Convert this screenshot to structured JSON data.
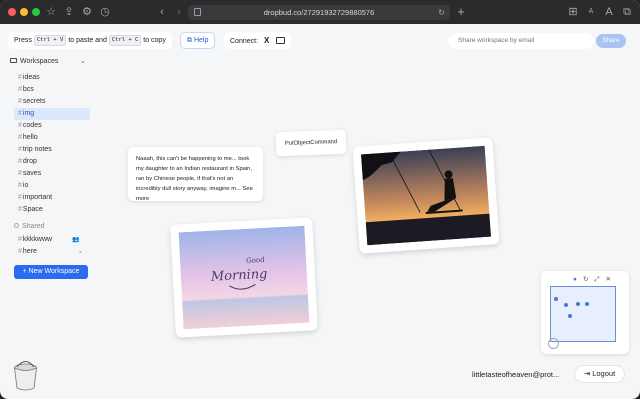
{
  "browser": {
    "url": "dropbud.co/27291932729880576",
    "controls": [
      "back",
      "forward",
      "reload",
      "new-tab"
    ]
  },
  "toolbar": {
    "paste_hint_press": "Press",
    "paste_key": "Ctrl + V",
    "paste_hint_mid": "to paste and",
    "copy_key": "Ctrl + C",
    "paste_hint_end": "to copy",
    "help_label": "Help",
    "connect_label": "Connect:",
    "connect_x": "X",
    "share_placeholder": "Share workspace by email",
    "share_button": "Share"
  },
  "sidebar": {
    "workspaces_label": "Workspaces",
    "channels": [
      {
        "label": "ideas"
      },
      {
        "label": "bcs"
      },
      {
        "label": "secrets"
      },
      {
        "label": "img",
        "active": true
      },
      {
        "label": "codes"
      },
      {
        "label": "hello"
      },
      {
        "label": "trip notes"
      },
      {
        "label": "drop"
      },
      {
        "label": "saves"
      },
      {
        "label": "io"
      },
      {
        "label": "important"
      },
      {
        "label": "Space"
      }
    ],
    "shared_label": "Shared",
    "shared": [
      {
        "label": "kkkkwww"
      },
      {
        "label": "here"
      }
    ],
    "new_workspace": "+ New Workspace"
  },
  "canvas": {
    "note_text": "Naaah, this can't be happening to me... took my daughter to an Indian restaurant in Spain, ran by Chinese people, if that's not an incredibly dull story anyway, imagine m...",
    "note_more": "See more",
    "command_text": "PutObjectCommand",
    "photo_morning_word1": "Good",
    "photo_morning_word2": "Morning"
  },
  "minimap": {
    "dots": 5
  },
  "footer": {
    "email": "littletasteofheaven@prot...",
    "logout": "Logout"
  },
  "colors": {
    "accent": "#2a6bf0",
    "active_bg": "#dbe7fb",
    "share_btn": "#a9c3f5"
  }
}
